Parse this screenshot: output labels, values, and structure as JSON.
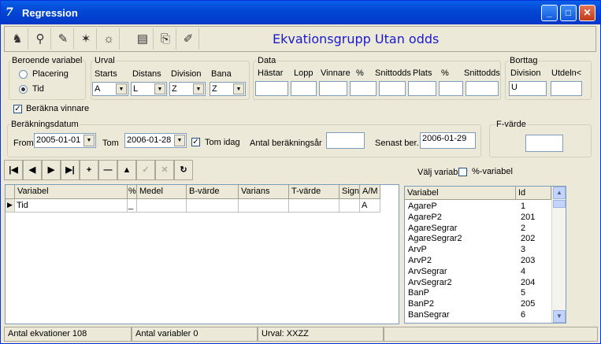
{
  "window": {
    "title": "Regression"
  },
  "heading": "Ekvationsgrupp Utan odds",
  "beroende": {
    "label": "Beroende variabel",
    "options": [
      "Placering",
      "Tid"
    ],
    "selected": "Tid"
  },
  "urval": {
    "label": "Urval",
    "cols": [
      "Starts",
      "Distans",
      "Division",
      "Bana"
    ],
    "values": [
      "A",
      "L",
      "Z",
      "Z"
    ]
  },
  "data": {
    "label": "Data",
    "cols": [
      "Hästar",
      "Lopp",
      "Vinnare",
      "%",
      "Snittodds",
      "Plats",
      "%",
      "Snittodds"
    ]
  },
  "borttag": {
    "label": "Borttag",
    "cols": [
      "Division",
      "Utdeln<"
    ],
    "values": [
      "U",
      ""
    ]
  },
  "berakna": {
    "label": "Beräkna vinnare"
  },
  "datum": {
    "label": "Beräkningsdatum",
    "from_label": "From",
    "from": "2005-01-01",
    "tom_label": "Tom",
    "tom": "2006-01-28",
    "tomidag_label": "Tom idag",
    "antal_label": "Antal beräkningsår",
    "antal": "",
    "senast_label": "Senast ber.",
    "senast": "2006-01-29"
  },
  "fvarde": {
    "label": "F-värde",
    "value": ""
  },
  "valj": {
    "label": "Välj variabler",
    "pct_label": "%-variabel"
  },
  "nav": [
    "|◀",
    "◀",
    "▶",
    "▶|",
    "+",
    "—",
    "▲",
    "✓",
    "✕",
    "↻"
  ],
  "main_grid": {
    "headers": [
      "Variabel",
      "%",
      "Medel",
      "B-värde",
      "Varians",
      "T-värde",
      "Sign",
      "A/M"
    ],
    "row": [
      "Tid",
      "_",
      "",
      "",
      "",
      "",
      "",
      "A"
    ]
  },
  "var_list": {
    "headers": [
      "Variabel",
      "Id"
    ],
    "rows": [
      [
        "AgareP",
        "1"
      ],
      [
        "AgareP2",
        "201"
      ],
      [
        "AgareSegrar",
        "2"
      ],
      [
        "AgareSegrar2",
        "202"
      ],
      [
        "ArvP",
        "3"
      ],
      [
        "ArvP2",
        "203"
      ],
      [
        "ArvSegrar",
        "4"
      ],
      [
        "ArvSegrar2",
        "204"
      ],
      [
        "BanP",
        "5"
      ],
      [
        "BanP2",
        "205"
      ],
      [
        "BanSegrar",
        "6"
      ]
    ]
  },
  "status": {
    "ekv": "Antal ekvationer 108",
    "var": "Antal variabler 0",
    "urval": "Urval: XXZZ"
  }
}
